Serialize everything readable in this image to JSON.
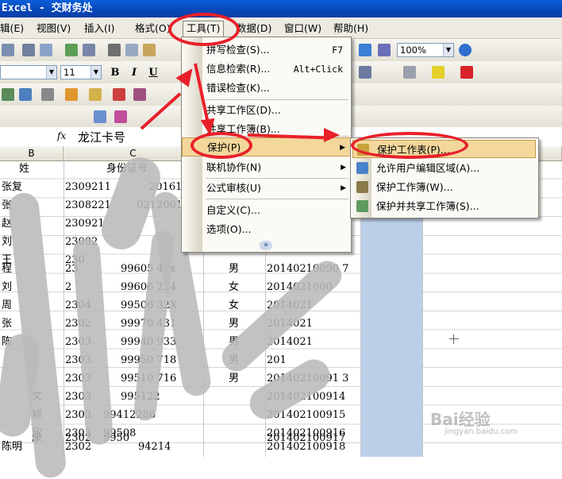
{
  "window": {
    "title": "Excel - 交财务处"
  },
  "menubar": {
    "items": [
      "辑(E)",
      "视图(V)",
      "插入(I)",
      "格式(O)",
      "工具(T)",
      "数据(D)",
      "窗口(W)",
      "帮助(H)"
    ]
  },
  "toolbar": {
    "zoom": "100%",
    "font_size": "11",
    "bold": "B",
    "italic": "I",
    "underline": "U"
  },
  "formula_bar": {
    "fx": "fx",
    "value": "龙江卡号"
  },
  "columns": [
    "B",
    "C"
  ],
  "headers": {
    "name": "姓",
    "id": "身份证号"
  },
  "rows": [
    {
      "name": "张复",
      "id": "2309211",
      "id2": "20161",
      "gender": "",
      "code": ""
    },
    {
      "name": "张",
      "id": "2308221",
      "id2": "0212001",
      "gender": "",
      "code": ""
    },
    {
      "name": "赵",
      "id": "230921",
      "id2": "",
      "gender": "",
      "code": ""
    },
    {
      "name": "刘",
      "id": "23092",
      "id2": "",
      "gender": "",
      "code": ""
    },
    {
      "name": "王",
      "id": "230",
      "id2": "",
      "gender": "",
      "code": ""
    },
    {
      "name": "程",
      "id": "23",
      "id2": "99605  41x",
      "gender": "男",
      "code": "20140210090 7"
    },
    {
      "name": "刘",
      "id": "2",
      "id2": "99606  224",
      "gender": "女",
      "code": "2014021000"
    },
    {
      "name": "周",
      "id": "2304",
      "id2": "99506  32X",
      "gender": "女",
      "code": "2014021"
    },
    {
      "name": "张",
      "id": "2302",
      "id2": "99970  431",
      "gender": "男",
      "code": "2014021"
    },
    {
      "name": "陈",
      "id": "2303",
      "id2": "99940  933",
      "gender": "男",
      "code": "2014021"
    },
    {
      "name": "",
      "id": "2303",
      "id2": "99950  718",
      "gender": "男",
      "code": "201"
    },
    {
      "name": "",
      "id": "2303",
      "id2": "99510  716",
      "gender": "男",
      "code": "20140210091 3"
    },
    {
      "name": "文",
      "id": "2303",
      "id2": "995122",
      "gender": "",
      "code": "201402100914"
    },
    {
      "name": "颖",
      "id": "2303",
      "id2": "99412286",
      "gender": "",
      "code": "201402100915"
    },
    {
      "name": "欣",
      "id": "2303",
      "id2": "99508",
      "gender": "",
      "code": "201402100916"
    },
    {
      "name": "康",
      "id": "2302",
      "id2": "9950",
      "gender": "",
      "code": "201402100917"
    },
    {
      "name": "陈明",
      "id": "2302",
      "id2": "94214",
      "gender": "",
      "code": "201402100918"
    }
  ],
  "tools_menu": {
    "items": [
      {
        "label": "拼写检查(S)...",
        "shortcut": "F7"
      },
      {
        "label": "信息检索(R)...",
        "shortcut": "Alt+Click"
      },
      {
        "label": "错误检查(K)...",
        "shortcut": ""
      },
      {
        "label": "共享工作区(D)...",
        "shortcut": ""
      },
      {
        "label": "共享工作簿(B)...",
        "shortcut": ""
      },
      {
        "label": "保护(P)",
        "shortcut": ""
      },
      {
        "label": "联机协作(N)",
        "shortcut": ""
      },
      {
        "label": "公式审核(U)",
        "shortcut": ""
      },
      {
        "label": "自定义(C)...",
        "shortcut": ""
      },
      {
        "label": "选项(O)...",
        "shortcut": ""
      }
    ],
    "expand": "»"
  },
  "protect_submenu": {
    "items": [
      "保护工作表(P)...",
      "允许用户编辑区域(A)...",
      "保护工作簿(W)...",
      "保护并共享工作簿(S)..."
    ]
  },
  "colors": {
    "accent_red": "#e8202a",
    "menu_highlight": "#f3d79b",
    "selected_column": "#b8cce8"
  },
  "watermark": {
    "text": "Bai经验",
    "sub": "jingyan.baidu.com"
  }
}
